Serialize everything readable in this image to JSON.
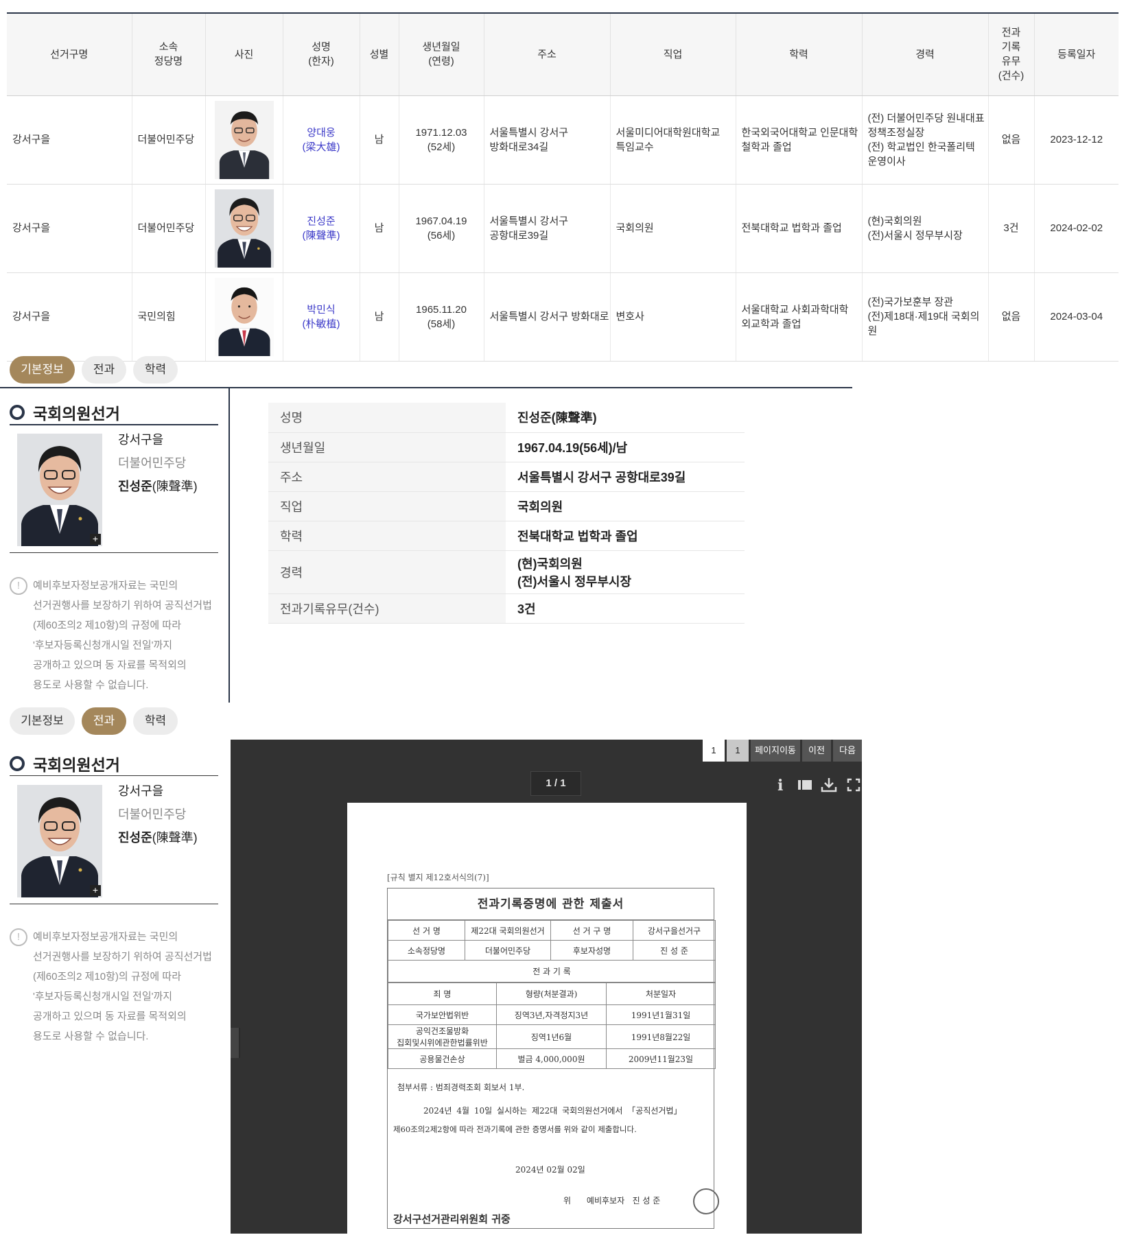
{
  "table": {
    "headers": [
      "선거구명",
      "소속\n정당명",
      "사진",
      "성명\n(한자)",
      "성별",
      "생년월일\n(연령)",
      "주소",
      "직업",
      "학력",
      "경력",
      "전과\n기록\n유무\n(건수)",
      "등록일자"
    ],
    "rows": [
      {
        "district": "강서구을",
        "party": "더불어민주당",
        "name": "양대웅",
        "hanja": "(梁大雄)",
        "gender": "남",
        "birth": "1971.12.03",
        "age": "(52세)",
        "address": "서울특별시 강서구\n방화대로34길",
        "job": "서울미디어대학원대학교\n특임교수",
        "edu": "한국외국어대학교 인문대학\n철학과 졸업",
        "career": "(전) 더불어민주당 원내대표\n정책조정실장\n(전) 학교법인 한국폴리텍\n운영이사",
        "crime": "없음",
        "date": "2023-12-12"
      },
      {
        "district": "강서구을",
        "party": "더불어민주당",
        "name": "진성준",
        "hanja": "(陳聲準)",
        "gender": "남",
        "birth": "1967.04.19",
        "age": "(56세)",
        "address": "서울특별시 강서구\n공항대로39길",
        "job": "국회의원",
        "edu": "전북대학교 법학과 졸업",
        "career": "(현)국회의원\n(전)서울시 정무부시장",
        "crime": "3건",
        "date": "2024-02-02"
      },
      {
        "district": "강서구을",
        "party": "국민의힘",
        "name": "박민식",
        "hanja": "(朴敏植)",
        "gender": "남",
        "birth": "1965.11.20",
        "age": "(58세)",
        "address": "서울특별시 강서구 방화대로",
        "job": "변호사",
        "edu": "서울대학교 사회과학대학\n외교학과 졸업",
        "career": "(전)국가보훈부 장관\n(전)제18대·제19대 국회의원",
        "crime": "없음",
        "date": "2024-03-04"
      }
    ]
  },
  "tabs": {
    "basic": "기본정보",
    "crime": "전과",
    "edu": "학력"
  },
  "section_title": "국회의원선거",
  "profile": {
    "district": "강서구을",
    "party": "더불어민주당",
    "name": "진성준",
    "hanja": "(陳聲準)"
  },
  "notice": "예비후보자정보공개자료는 국민의 선거권행사를 보장하기 위하여 공직선거법(제60조의2 제10항)의 규정에 따라 '후보자등록신청개시일 전일'까지 공개하고 있으며 동 자료를 목적외의 용도로 사용할 수 없습니다.",
  "notice_lines": [
    "예비후보자정보공개자료는 국민의",
    "선거권행사를 보장하기 위하여 공직선거법",
    "(제60조의2 제10항)의 규정에 따라",
    "'후보자등록신청개시일 전일'까지",
    "공개하고 있으며 동 자료를 목적외의",
    "용도로 사용할 수 없습니다."
  ],
  "detail": [
    {
      "label": "성명",
      "value": "진성준(陳聲準)"
    },
    {
      "label": "생년월일",
      "value": "1967.04.19(56세)/남"
    },
    {
      "label": "주소",
      "value": "서울특별시 강서구 공항대로39길"
    },
    {
      "label": "직업",
      "value": "국회의원"
    },
    {
      "label": "학력",
      "value": "전북대학교 법학과 졸업"
    },
    {
      "label": "경력",
      "value": "(현)국회의원\n(전)서울시 정무부시장"
    },
    {
      "label": "전과기록유무(건수)",
      "value": "3건"
    }
  ],
  "viewer": {
    "pager": {
      "current": "1",
      "page": "1",
      "goto": "페이지이동",
      "prev": "이전",
      "next": "다음"
    },
    "page_indicator": "1 / 1",
    "tools": [
      "info-icon",
      "layout-icon",
      "download-icon",
      "fullscreen-icon"
    ],
    "tool_glyphs": {
      "info": "i"
    }
  },
  "document": {
    "form_id": "[규칙 별지 제12호서식의(7)]",
    "title": "전과기록증명에 관한 제출서",
    "row1": [
      "선 거 명",
      "제22대 국회의원선거",
      "선 거 구 명",
      "강서구을선거구"
    ],
    "row2": [
      "소속정당명",
      "더불어민주당",
      "후보자성명",
      "진 성 준"
    ],
    "section": "전 과 기 록",
    "crime_headers": [
      "죄 명",
      "형량(처분결과)",
      "처분일자"
    ],
    "crimes": [
      [
        "국가보안법위반",
        "징역3년,자격정지3년",
        "1991년1월31일"
      ],
      [
        "공익건조물방화\n집회및시위에관한법률위반",
        "징역1년6월",
        "1991년8월22일"
      ],
      [
        "공용물건손상",
        "벌금 4,000,000원",
        "2009년11월23일"
      ]
    ],
    "attachment": "첨부서류 : 범죄경력조회 회보서 1부.",
    "body_line1": "2024년 4월 10일 실시하는 제22대 국회의원선거에서 「공직선거법」",
    "body_line2": "제60조의2제2항에 따라 전과기록에 관한 증명서를 위와 같이 제출합니다.",
    "date": "2024년 02월 02일",
    "signer": "위      예비후보자   진 성 준",
    "addressee": "강서구선거관리위원회 귀중"
  }
}
